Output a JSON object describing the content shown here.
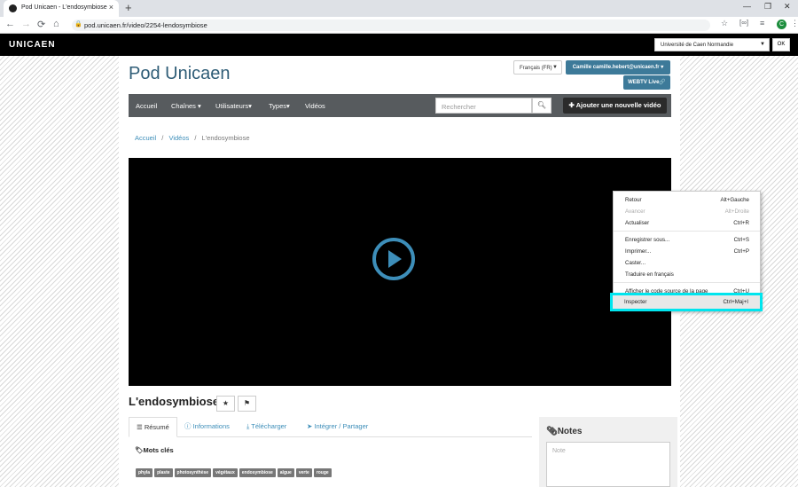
{
  "browser": {
    "tab_title": "Pod Unicaen - L'endosymbiose",
    "tab_close": "×",
    "new_tab": "+",
    "url": "pod.unicaen.fr/video/2254-lendosymbiose",
    "avatar_letter": "C",
    "win_min": "—",
    "win_restore": "❐",
    "win_close": "✕"
  },
  "site_header": {
    "logo": "UNICAEN",
    "university_select": "Université de Caen Normandie",
    "ok_label": "OK"
  },
  "header": {
    "title": "Pod Unicaen",
    "language": "Français (FR)",
    "user_button": "Camille camille.hebert@unicaen.fr ▾",
    "webtv_button": "WEBTV Live🔗"
  },
  "navbar": {
    "items": [
      {
        "label": "Accueil"
      },
      {
        "label": "Chaînes ▾"
      },
      {
        "label": "Utilisateurs▾"
      },
      {
        "label": "Types▾"
      },
      {
        "label": "Vidéos"
      }
    ],
    "search_placeholder": "Rechercher",
    "add_video": "Ajouter une nouvelle vidéo"
  },
  "breadcrumb": {
    "home": "Accueil",
    "videos": "Vidéos",
    "current": "L'endosymbiose",
    "sep": "/"
  },
  "video": {
    "title": "L'endosymbiose"
  },
  "tabs": [
    {
      "label": "Résumé"
    },
    {
      "label": "Informations"
    },
    {
      "label": "Télécharger"
    },
    {
      "label": "Intégrer / Partager"
    }
  ],
  "keywords": {
    "heading": "Mots clés",
    "tags": [
      "phyla",
      "plaste",
      "photosynthèse",
      "végétaux",
      "endosymbiose",
      "algue",
      "verte",
      "rouge"
    ]
  },
  "notes": {
    "heading": "Notes",
    "placeholder": "Note"
  },
  "context_menu": {
    "items": [
      {
        "label": "Retour",
        "shortcut": "Alt+Gauche",
        "disabled": false
      },
      {
        "label": "Avancer",
        "shortcut": "Alt+Droite",
        "disabled": true
      },
      {
        "label": "Actualiser",
        "shortcut": "Ctrl+R",
        "disabled": false
      },
      {
        "label": "Enregistrer sous...",
        "shortcut": "Ctrl+S",
        "disabled": false
      },
      {
        "label": "Imprimer...",
        "shortcut": "Ctrl+P",
        "disabled": false
      },
      {
        "label": "Caster...",
        "shortcut": "",
        "disabled": false
      },
      {
        "label": "Traduire en français",
        "shortcut": "",
        "disabled": false
      },
      {
        "label": "Afficher le code source de la page",
        "shortcut": "Ctrl+U",
        "disabled": false
      },
      {
        "label": "Inspecter",
        "shortcut": "Ctrl+Maj+I",
        "disabled": false
      }
    ],
    "highlight_color": "#00e5ee"
  }
}
